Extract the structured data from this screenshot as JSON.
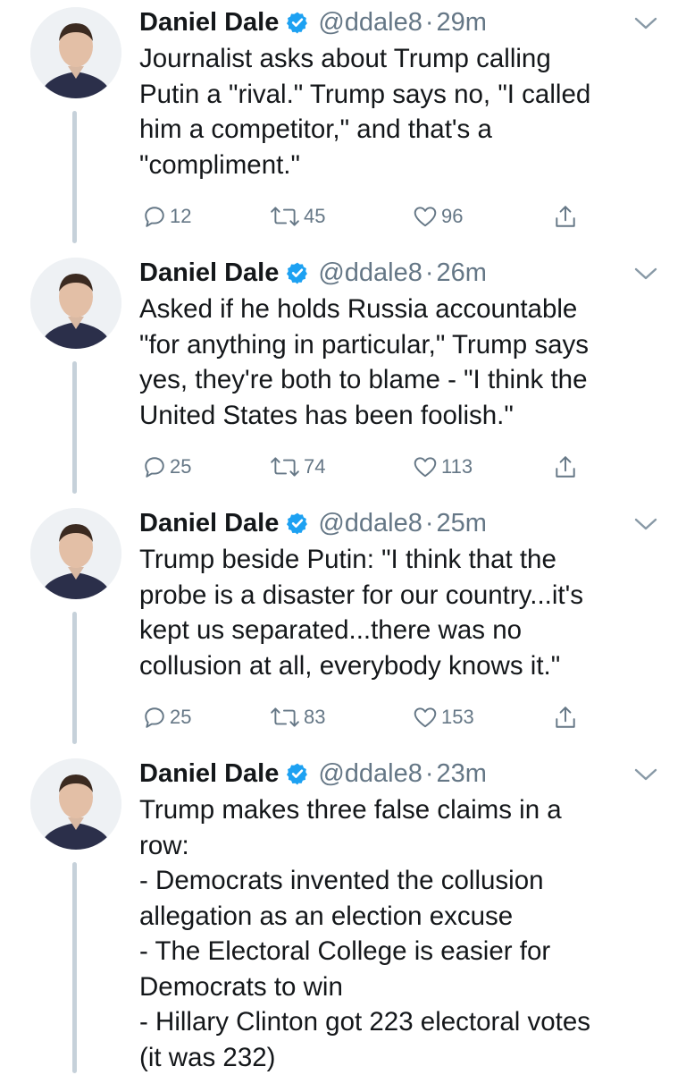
{
  "tweets": [
    {
      "name": "Daniel Dale",
      "handle": "@ddale8",
      "separator": "·",
      "time": "29m",
      "lines": [
        "Journalist asks about Trump calling",
        "Putin a \"rival.\" Trump says no, \"I called",
        "him a competitor,\" and that's a",
        "\"compliment.\""
      ],
      "replies": "12",
      "retweets": "45",
      "likes": "96"
    },
    {
      "name": "Daniel Dale",
      "handle": "@ddale8",
      "separator": "·",
      "time": "26m",
      "lines": [
        "Asked if he holds Russia accountable",
        "\"for anything in particular,\" Trump says",
        "yes, they're both to blame - \"I think the",
        "United States has been foolish.\""
      ],
      "replies": "25",
      "retweets": "74",
      "likes": "113"
    },
    {
      "name": "Daniel Dale",
      "handle": "@ddale8",
      "separator": "·",
      "time": "25m",
      "lines": [
        "Trump beside Putin: \"I think that the",
        "probe is a disaster for our country...it's",
        "kept us separated...there was no",
        "collusion at all, everybody knows it.\""
      ],
      "replies": "25",
      "retweets": "83",
      "likes": "153"
    },
    {
      "name": "Daniel Dale",
      "handle": "@ddale8",
      "separator": "·",
      "time": "23m",
      "lines": [
        "Trump makes three false claims in a",
        "row:",
        "- Democrats invented the collusion",
        "allegation as an election excuse",
        "- The Electoral College is easier for",
        "Democrats to win",
        "- Hillary Clinton got 223 electoral votes",
        "(it was 232)"
      ]
    }
  ],
  "icons": {
    "verified": "verified-badge-icon",
    "more": "chevron-down-icon",
    "reply": "reply-icon",
    "retweet": "retweet-icon",
    "like": "heart-icon",
    "share": "share-icon"
  },
  "colors": {
    "text": "#14171a",
    "secondary": "#657786",
    "verified": "#1da1f2",
    "thread_line": "#c6d1da"
  }
}
